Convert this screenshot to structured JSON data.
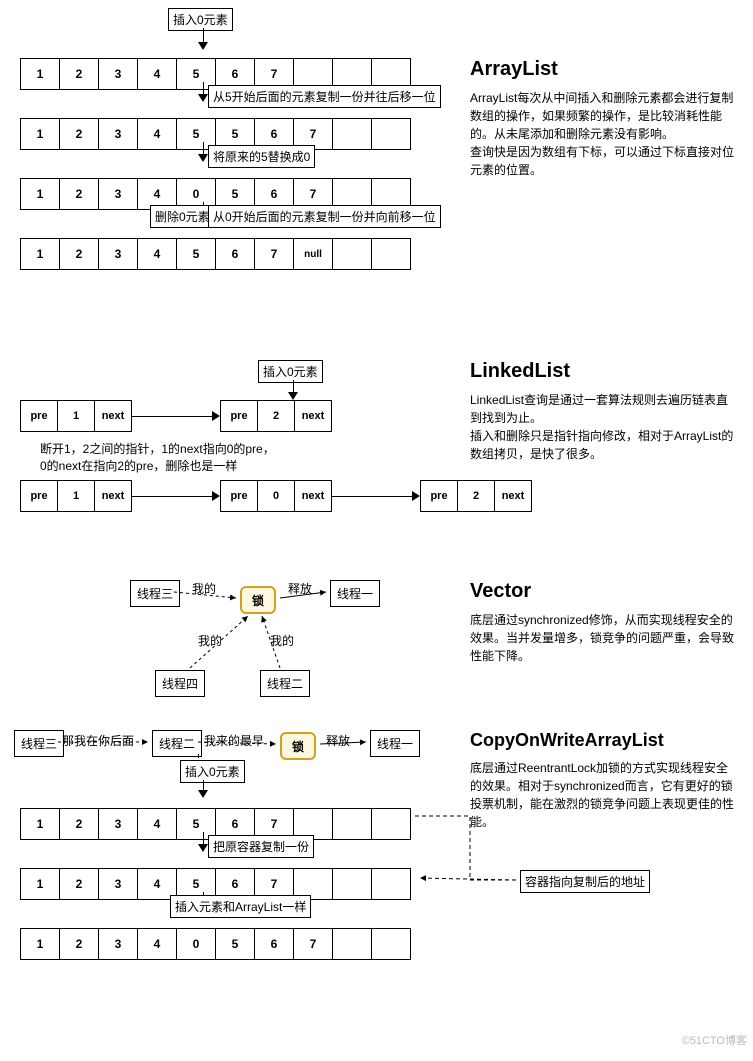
{
  "arraylist": {
    "title": "ArrayList",
    "desc": "ArrayList每次从中间插入和删除元素都会进行复制数组的操作，如果频繁的操作，是比较消耗性能的。从未尾添加和删除元素没有影响。\n查询快是因为数组有下标，可以通过下标直接对位元素的位置。",
    "top_label": "插入0元素",
    "step1": "从5开始后面的元素复制一份并往后移一位",
    "step2": "将原来的5替换成0",
    "step3a": "删除0元素",
    "step3b": "从0开始后面的元素复制一份并向前移一位",
    "row1": [
      "1",
      "2",
      "3",
      "4",
      "5",
      "6",
      "7",
      "",
      "",
      ""
    ],
    "row2": [
      "1",
      "2",
      "3",
      "4",
      "5",
      "5",
      "6",
      "7",
      "",
      ""
    ],
    "row3": [
      "1",
      "2",
      "3",
      "4",
      "0",
      "5",
      "6",
      "7",
      "",
      ""
    ],
    "row4": [
      "1",
      "2",
      "3",
      "4",
      "5",
      "6",
      "7",
      "null",
      "",
      ""
    ]
  },
  "linkedlist": {
    "title": "LinkedList",
    "desc": "LinkedList查询是通过一套算法规则去遍历链表直到找到为止。\n插入和删除只是指针指向修改，相对于ArrayList的数组拷贝，是快了很多。",
    "top_label": "插入0元素",
    "note": "断开1，2之间的指针，1的next指向0的pre，\n0的next在指向2的pre，删除也是一样",
    "node_a": [
      "pre",
      "1",
      "next"
    ],
    "node_b": [
      "pre",
      "2",
      "next"
    ],
    "node_c": [
      "pre",
      "1",
      "next"
    ],
    "node_d": [
      "pre",
      "0",
      "next"
    ],
    "node_e": [
      "pre",
      "2",
      "next"
    ]
  },
  "vector": {
    "title": "Vector",
    "desc": "底层通过synchronized修饰，从而实现线程安全的效果。当并发量增多，锁竞争的问题严重，会导致性能下降。",
    "lock": "锁",
    "t1": "线程一",
    "t2": "线程二",
    "t3": "线程三",
    "t4": "线程四",
    "mine": "我的",
    "release": "释放"
  },
  "cow": {
    "title": "CopyOnWriteArrayList",
    "desc": "底层通过ReentrantLock加锁的方式实现线程安全的效果。相对于synchronized而言，它有更好的锁投票机制，能在激烈的锁竞争问题上表现更佳的性能。",
    "lock": "锁",
    "t1": "线程一",
    "t2": "线程二",
    "t3": "线程三",
    "l1": "那我在你后面",
    "l2": "我来的最早",
    "release": "释放",
    "insert": "插入0元素",
    "step1": "把原容器复制一份",
    "step2": "插入元素和ArrayList一样",
    "ptr": "容器指向复制后的地址",
    "row1": [
      "1",
      "2",
      "3",
      "4",
      "5",
      "6",
      "7",
      "",
      "",
      ""
    ],
    "row2": [
      "1",
      "2",
      "3",
      "4",
      "5",
      "6",
      "7",
      "",
      "",
      ""
    ],
    "row3": [
      "1",
      "2",
      "3",
      "4",
      "0",
      "5",
      "6",
      "7",
      "",
      ""
    ]
  },
  "watermark": "©51CTO博客"
}
